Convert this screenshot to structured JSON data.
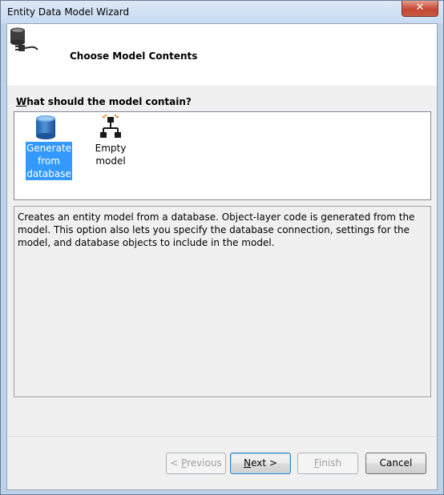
{
  "window": {
    "title": "Entity Data Model Wizard",
    "close_glyph": "✕"
  },
  "header": {
    "title": "Choose Model Contents",
    "icon": "database-plug-icon"
  },
  "question": {
    "lead": "W",
    "rest": "hat should the model contain?"
  },
  "options": [
    {
      "lines": [
        "Generate",
        "from",
        "database"
      ],
      "icon": "database-icon",
      "selected": true
    },
    {
      "lines": [
        "Empty model"
      ],
      "icon": "hierarchy-icon",
      "selected": false
    }
  ],
  "description": "Creates an entity model from a database. Object-layer code is generated from the model. This option also lets you specify the database connection, settings for the model, and database objects to include in the model.",
  "buttons": {
    "previous": {
      "prefix": "< ",
      "key": "P",
      "rest": "revious"
    },
    "next": {
      "key": "N",
      "rest": "ext >"
    },
    "finish": {
      "key": "F",
      "rest": "inish"
    },
    "cancel": {
      "label": "Cancel"
    }
  },
  "colors": {
    "selection": "#3399ff",
    "close": "#c64733"
  }
}
